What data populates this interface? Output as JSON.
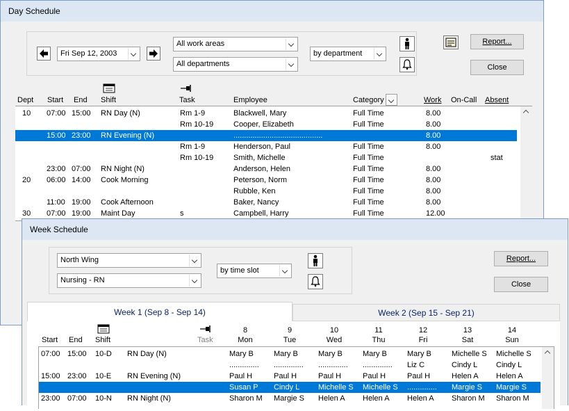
{
  "day": {
    "title": "Day Schedule",
    "date": "Fri Sep 12, 2003",
    "area": "All work areas",
    "dept": "All departments",
    "view": "by department",
    "report": "Report...",
    "close": "Close",
    "headers": {
      "dept": "Dept",
      "start": "Start",
      "end": "End",
      "shift": "Shift",
      "task": "Task",
      "employee": "Employee",
      "category": "Category",
      "work": "Work",
      "oncall": "On-Call",
      "absent": "Absent"
    },
    "rows": [
      {
        "dept": "10",
        "start": "07:00",
        "end": "15:00",
        "shift": "RN Day (N)",
        "task": "Rm 1-9",
        "employee": "Blackwell, Mary",
        "category": "Full Time",
        "work": "8.00",
        "absent": ""
      },
      {
        "dept": "",
        "start": "",
        "end": "",
        "shift": "",
        "task": "Rm 10-19",
        "employee": "Cooper, Elizabeth",
        "category": "Full Time",
        "work": "8.00",
        "absent": ""
      },
      {
        "dept": "",
        "start": "15:00",
        "end": "23:00",
        "shift": "RN Evening (N)",
        "task": "",
        "employee": "..........................................",
        "category": "",
        "work": "8.00",
        "absent": "",
        "selected": true
      },
      {
        "dept": "",
        "start": "",
        "end": "",
        "shift": "",
        "task": "Rm 1-9",
        "employee": "Henderson, Paul",
        "category": "Full Time",
        "work": "8.00",
        "absent": ""
      },
      {
        "dept": "",
        "start": "",
        "end": "",
        "shift": "",
        "task": "Rm 10-19",
        "employee": "Smith, Michelle",
        "category": "Full Time",
        "work": "",
        "absent": "stat"
      },
      {
        "dept": "",
        "start": "23:00",
        "end": "07:00",
        "shift": "RN Night (N)",
        "task": "",
        "employee": "Anderson, Helen",
        "category": "Full Time",
        "work": "8.00",
        "absent": ""
      },
      {
        "dept": "20",
        "start": "06:00",
        "end": "14:00",
        "shift": "Cook Morning",
        "task": "",
        "employee": "Peterson, Norm",
        "category": "Full Time",
        "work": "8.00",
        "absent": ""
      },
      {
        "dept": "",
        "start": "",
        "end": "",
        "shift": "",
        "task": "",
        "employee": "Rubble, Ken",
        "category": "Full Time",
        "work": "8.00",
        "absent": ""
      },
      {
        "dept": "",
        "start": "11:00",
        "end": "19:00",
        "shift": "Cook Afternoon",
        "task": "",
        "employee": "Baker, Nancy",
        "category": "Full Time",
        "work": "8.00",
        "absent": ""
      },
      {
        "dept": "30",
        "start": "07:00",
        "end": "19:00",
        "shift": "Maint Day",
        "task": "s",
        "employee": "Campbell, Harry",
        "category": "Full Time",
        "work": "12.00",
        "absent": ""
      }
    ]
  },
  "week": {
    "title": "Week Schedule",
    "area": "North Wing",
    "dept": "Nursing - RN",
    "view": "by time slot",
    "report": "Report...",
    "close": "Close",
    "tab1": "Week 1  (Sep 8 - Sep 14)",
    "tab2": "Week 2  (Sep 15 - Sep 21)",
    "headers": {
      "start": "Start",
      "end": "End",
      "shift": "Shift",
      "task": "Task"
    },
    "days": [
      {
        "num": "8",
        "name": "Mon"
      },
      {
        "num": "9",
        "name": "Tue"
      },
      {
        "num": "10",
        "name": "Wed"
      },
      {
        "num": "11",
        "name": "Thu"
      },
      {
        "num": "12",
        "name": "Fri"
      },
      {
        "num": "13",
        "name": "Sat"
      },
      {
        "num": "14",
        "name": "Sun"
      }
    ],
    "rows": [
      {
        "start": "07:00",
        "end": "15:00",
        "shift": "10-D",
        "name": "RN Day (N)",
        "cells": [
          "Mary B",
          "Mary B",
          "Mary B",
          "Mary B",
          "Mary B",
          "Michelle S",
          "Michelle S"
        ]
      },
      {
        "start": "",
        "end": "",
        "shift": "",
        "name": "",
        "cells": [
          "..............",
          "..............",
          "..............",
          "..............",
          "Liz C",
          "Cindy L",
          "Cindy L"
        ]
      },
      {
        "start": "15:00",
        "end": "23:00",
        "shift": "10-E",
        "name": "RN Evening (N)",
        "cells": [
          "Paul H",
          "Paul H",
          "Paul H",
          "Paul H",
          "Paul H",
          "Helen A",
          "Helen A"
        ]
      },
      {
        "start": "",
        "end": "",
        "shift": "",
        "name": "",
        "cells": [
          "Susan P",
          "Cindy L",
          "Michelle S",
          "Michelle S",
          "..............",
          "Margie S",
          "Margie S"
        ],
        "selected": true
      },
      {
        "start": "23:00",
        "end": "07:00",
        "shift": "10-N",
        "name": "RN Night (N)",
        "cells": [
          "Sharon M",
          "Margie S",
          "Helen A",
          "Helen A",
          "Helen A",
          "Sharon M",
          "Sharon M"
        ]
      }
    ]
  },
  "icons": {
    "prev": "arrow-left-icon",
    "next": "arrow-right-icon",
    "person": "person-icon",
    "bell": "bell-icon",
    "note": "note-icon",
    "shift": "calendar-icon",
    "task": "pin-icon"
  }
}
